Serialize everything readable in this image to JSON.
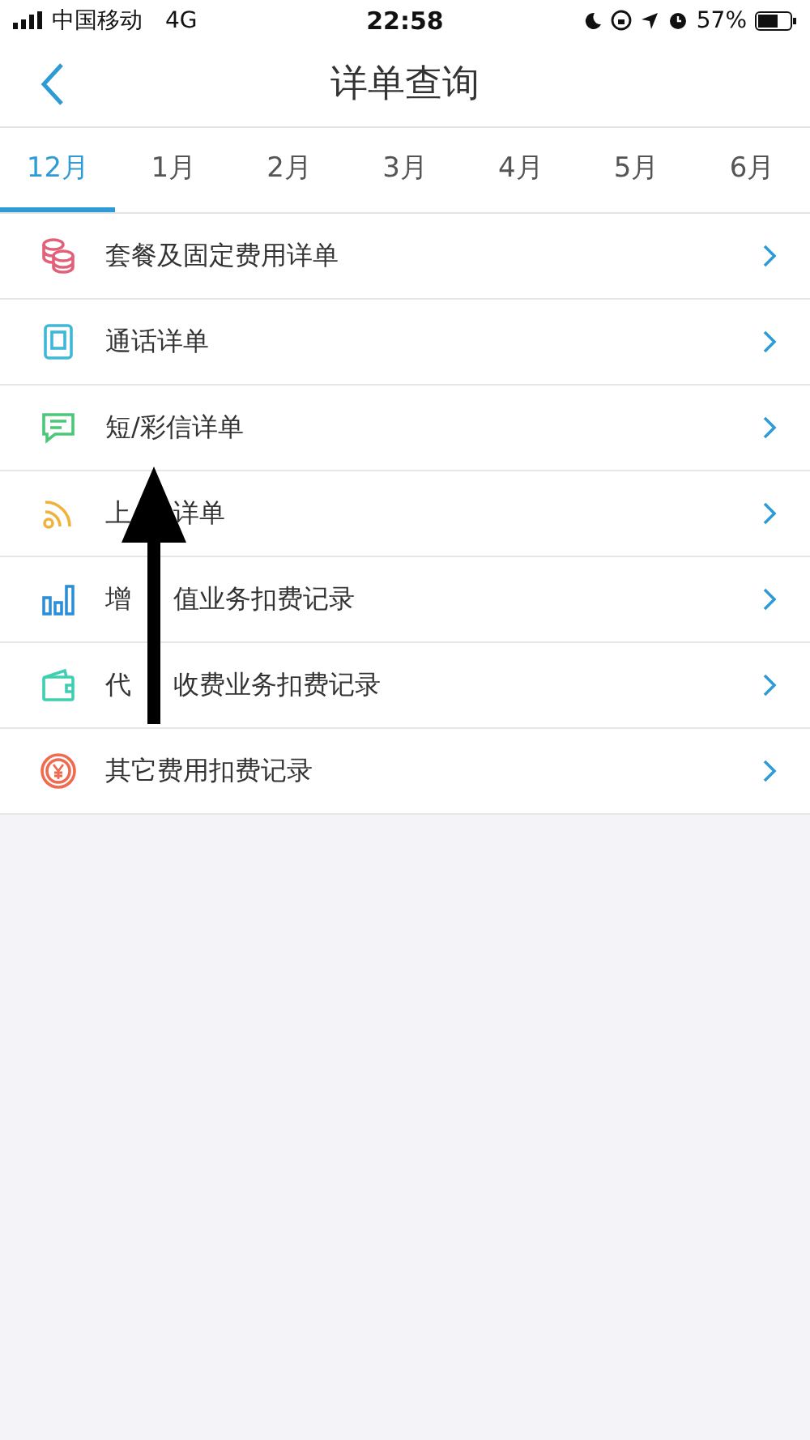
{
  "status_bar": {
    "carrier": "中国移动",
    "network": "4G",
    "time": "22:58",
    "battery": "57%"
  },
  "nav": {
    "title": "详单查询"
  },
  "tabs": [
    {
      "label": "12月",
      "selected": true
    },
    {
      "label": "1月",
      "selected": false
    },
    {
      "label": "2月",
      "selected": false
    },
    {
      "label": "3月",
      "selected": false
    },
    {
      "label": "4月",
      "selected": false
    },
    {
      "label": "5月",
      "selected": false
    },
    {
      "label": "6月",
      "selected": false
    }
  ],
  "items": [
    {
      "kind": "coins",
      "color": "#e2617a",
      "label_parts": [
        "套餐及固定费用详单"
      ]
    },
    {
      "kind": "phone",
      "color": "#3fb7d9",
      "label_parts": [
        "通话详单"
      ]
    },
    {
      "kind": "message",
      "color": "#4cc77a",
      "label_parts": [
        "短/彩信详单"
      ]
    },
    {
      "kind": "signal",
      "color": "#f0b23a",
      "label_parts": [
        "上",
        "详单"
      ]
    },
    {
      "kind": "bars",
      "color": "#2f8fd6",
      "label_parts": [
        "增",
        "值业务扣费记录"
      ]
    },
    {
      "kind": "wallet",
      "color": "#3fcfb0",
      "label_parts": [
        "代",
        "收费业务扣费记录"
      ]
    },
    {
      "kind": "yen",
      "color": "#ef6a4f",
      "label_parts": [
        "其它费用扣费记录"
      ]
    }
  ]
}
